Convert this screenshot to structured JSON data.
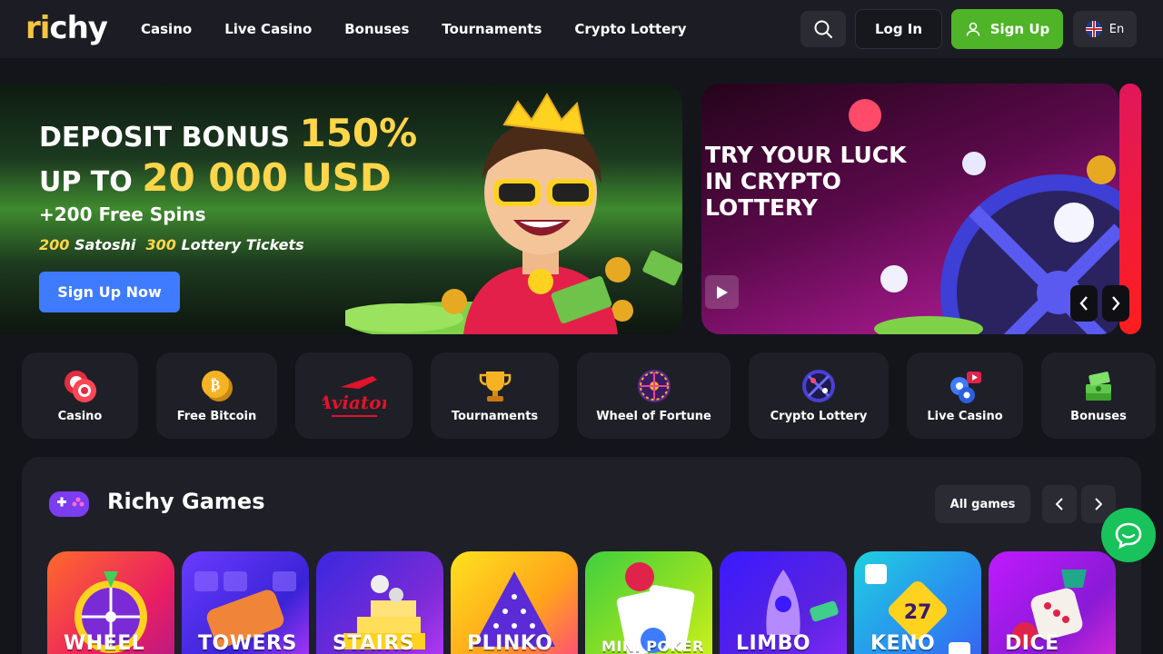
{
  "header": {
    "logo_text": "richy",
    "nav": [
      "Casino",
      "Live Casino",
      "Bonuses",
      "Tournaments",
      "Crypto Lottery"
    ],
    "login_label": "Log In",
    "signup_label": "Sign Up",
    "language": "En"
  },
  "hero": {
    "line1_prefix": "DEPOSIT BONUS",
    "line1_highlight": "150%",
    "line2_prefix": "UP TO",
    "line2_highlight": "20 000 USD",
    "line3": "+200 Free Spins",
    "line4_num1": "200",
    "line4_text1": "Satoshi",
    "line4_num2": "300",
    "line4_text2": "Lottery Tickets",
    "cta_label": "Sign Up Now"
  },
  "hero2": {
    "title": "TRY YOUR LUCK IN CRYPTO LOTTERY"
  },
  "categories": [
    {
      "label": "Casino"
    },
    {
      "label": "Free Bitcoin"
    },
    {
      "label": "Aviator"
    },
    {
      "label": "Tournaments"
    },
    {
      "label": "Wheel of Fortune"
    },
    {
      "label": "Crypto Lottery"
    },
    {
      "label": "Live Casino"
    },
    {
      "label": "Bonuses"
    }
  ],
  "games_section": {
    "title": "Richy Games",
    "all_games_label": "All games",
    "games": [
      "WHEEL",
      "TOWERS",
      "STAIRS",
      "PLINKO",
      "MINI POKER",
      "LIMBO",
      "KENO",
      "DICE"
    ]
  },
  "colors": {
    "background": "#14151b",
    "header": "#1c1d24",
    "accent_green": "#4fb427",
    "accent_blue": "#3f7bff",
    "highlight_yellow": "#ffd64a"
  }
}
